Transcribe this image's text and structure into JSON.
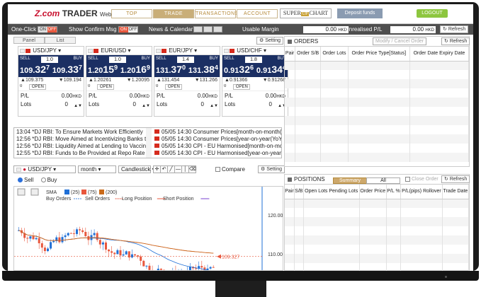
{
  "brand": {
    "z": "Z.com",
    "trader": "TRADER",
    "web": "Web"
  },
  "nav": {
    "tabs": [
      "TOP",
      "TRADE",
      "TRANSACTIONS",
      "ACCOUNT"
    ],
    "active": "TRADE",
    "superchart": "SUPER",
    "superchart_up": "UP",
    "superchart_tail": "CHART",
    "deposit": "Deposit funds",
    "logout": "LOGOUT"
  },
  "toolbar": {
    "one_click": "One-Click",
    "on": "ON",
    "off": "OFF",
    "show_confirm": "Show Confirm Msg",
    "news_cal": "News & Calendar",
    "usable_margin": "Usable Margin",
    "usable_margin_value": "0.00",
    "unrealised": "Unrealised P/L",
    "unrealised_value": "0.00",
    "currency": "HKD",
    "refresh": "Refresh"
  },
  "panel": {
    "panel": "Panel",
    "list": "List",
    "setting": "Setting"
  },
  "tiles": [
    {
      "pair": "USD/JPY",
      "sell": "SELL",
      "buy": "BUY",
      "spread": "1.0",
      "lots_ctrl": "1.0",
      "sell_big": "109.",
      "sell_pip": "32",
      "sell_frac": "7",
      "buy_big": "109.",
      "buy_pip": "33",
      "buy_frac": "7",
      "high": "109.375",
      "low": "109.194",
      "pos": "0",
      "open": "OPEN",
      "pl_label": "P/L",
      "pl": "0.00",
      "pl_ccy": "HKD",
      "lots_label": "Lots",
      "lots": "0"
    },
    {
      "pair": "EUR/USD",
      "sell": "SELL",
      "buy": "BUY",
      "spread": "1.0",
      "lots_ctrl": "1.0",
      "sell_big": "1.20",
      "sell_pip": "15",
      "sell_frac": "9",
      "buy_big": "1.20",
      "buy_pip": "16",
      "buy_frac": "9",
      "high": "1.20261",
      "low": "1.20095",
      "pos": "0",
      "open": "OPEN",
      "pl_label": "P/L",
      "pl": "0.00",
      "pl_ccy": "HKD",
      "lots_label": "Lots",
      "lots": "0"
    },
    {
      "pair": "EUR/JPY",
      "sell": "SELL",
      "buy": "BUY",
      "spread": "1.4",
      "lots_ctrl": "1.4",
      "sell_big": "131.",
      "sell_pip": "37",
      "sell_frac": "0",
      "buy_big": "131.",
      "buy_pip": "38",
      "buy_frac": "4",
      "high": "131.454",
      "low": "131.266",
      "pos": "0",
      "open": "OPEN",
      "pl_label": "P/L",
      "pl": "0.00",
      "pl_ccy": "HKD",
      "lots_label": "Lots",
      "lots": "0"
    },
    {
      "pair": "USD/CHF",
      "sell": "SELL",
      "buy": "BUY",
      "spread": "1.8",
      "lots_ctrl": "1.8",
      "sell_big": "0.91",
      "sell_pip": "32",
      "sell_frac": "6",
      "buy_big": "0.91",
      "buy_pip": "34",
      "buy_frac": "4",
      "high": "0.91366",
      "low": "0.91268",
      "pos": "0",
      "open": "OPEN",
      "pl_label": "P/L",
      "pl": "0.00",
      "pl_ccy": "HKD",
      "lots_label": "Lots",
      "lots": "0"
    }
  ],
  "news": [
    "13:04 *DJ RBI: To Ensure Markets Work Efficiently",
    "12:56 *DJ RBI: Move Aimed at Incentivizing Banks to",
    "12:56 *DJ RBI: Liquidity Aimed at Lending to Vaccine",
    "12:55 *DJ RBI: Funds to Be Provided at Repo Rate Till"
  ],
  "calendar": [
    "05/05 14:30  Consumer Prices[month-on-month(",
    "05/05 14:30  Consumer Prices[year-on-year(YoY)]",
    "05/05 14:30  CPI - EU Harmonised[month-on-mo",
    "05/05 14:30  CPI - EU Harmonised[year-on-year("
  ],
  "chart_ctl": {
    "pair": "USD/JPY",
    "period": "month",
    "type": "Candlestick",
    "compare": "Compare",
    "setting": "Setting",
    "sell": "Sell",
    "buy": "Buy",
    "sma": "SMA",
    "sma1": "(25)",
    "sma2": "(75)",
    "sma3": "(200)",
    "buy_orders": "Buy Orders",
    "sell_orders": "Sell Orders",
    "long_pos": "Long Position",
    "short_pos": "Short Position",
    "price_label": "109.327",
    "axis": [
      "120.000",
      "110.000"
    ]
  },
  "orders": {
    "title": "ORDERS",
    "modify": "Modify / Cancel Order",
    "refresh": "Refresh",
    "cols": [
      "Pair",
      "Order S/B",
      "Order Lots",
      "Order Price Type[Status]",
      "Order Date Expiry Date"
    ]
  },
  "positions": {
    "title": "POSITIONS",
    "summary": "Summary",
    "all": "All",
    "close": "Close Order",
    "refresh": "Refresh",
    "cols": [
      "Pair",
      "S/B",
      "Open Lots Pending Lots",
      "Order Price",
      "P/L %",
      "P/L(pips) Rollover",
      "Trade Date"
    ]
  },
  "colors": {
    "accent": "#c9ae78",
    "quote_bg": "#1b2f63",
    "sell": "#c8102e",
    "sma25": "#1f6fd6",
    "sma75": "#e8573d",
    "sma200": "#c96a1a"
  }
}
